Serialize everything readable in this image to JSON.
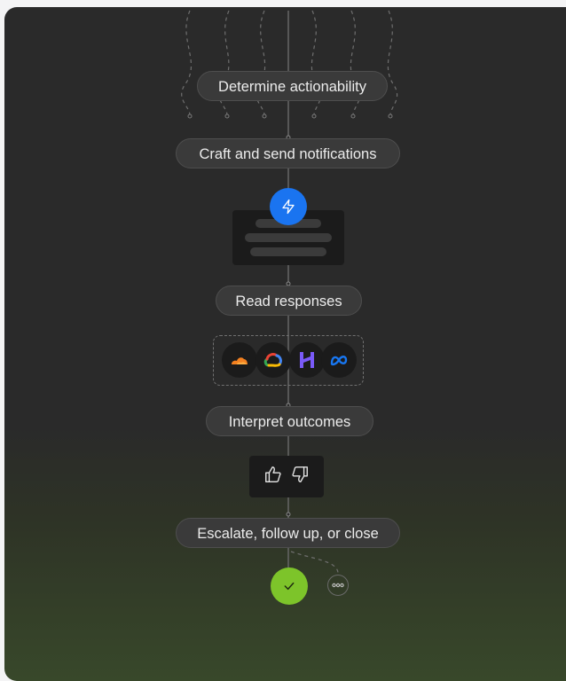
{
  "steps": [
    {
      "label": "Determine actionability"
    },
    {
      "label": "Craft and send notifications"
    },
    {
      "label": "Read responses"
    },
    {
      "label": "Interpret outcomes"
    },
    {
      "label": "Escalate, follow up, or close"
    }
  ],
  "icons": {
    "notification": "lightning-bolt-icon",
    "providers": [
      "cloudflare-icon",
      "google-cloud-icon",
      "heroku-icon",
      "meta-icon"
    ],
    "feedback": [
      "thumbs-up-icon",
      "thumbs-down-icon"
    ],
    "outcomes": [
      "checkmark-icon",
      "more-options-icon"
    ]
  },
  "colors": {
    "bolt": "#1a74f0",
    "check": "#7dc42a",
    "cloudflare": "#f48120",
    "heroku": "#7a5af8",
    "meta": "#1877f2"
  }
}
